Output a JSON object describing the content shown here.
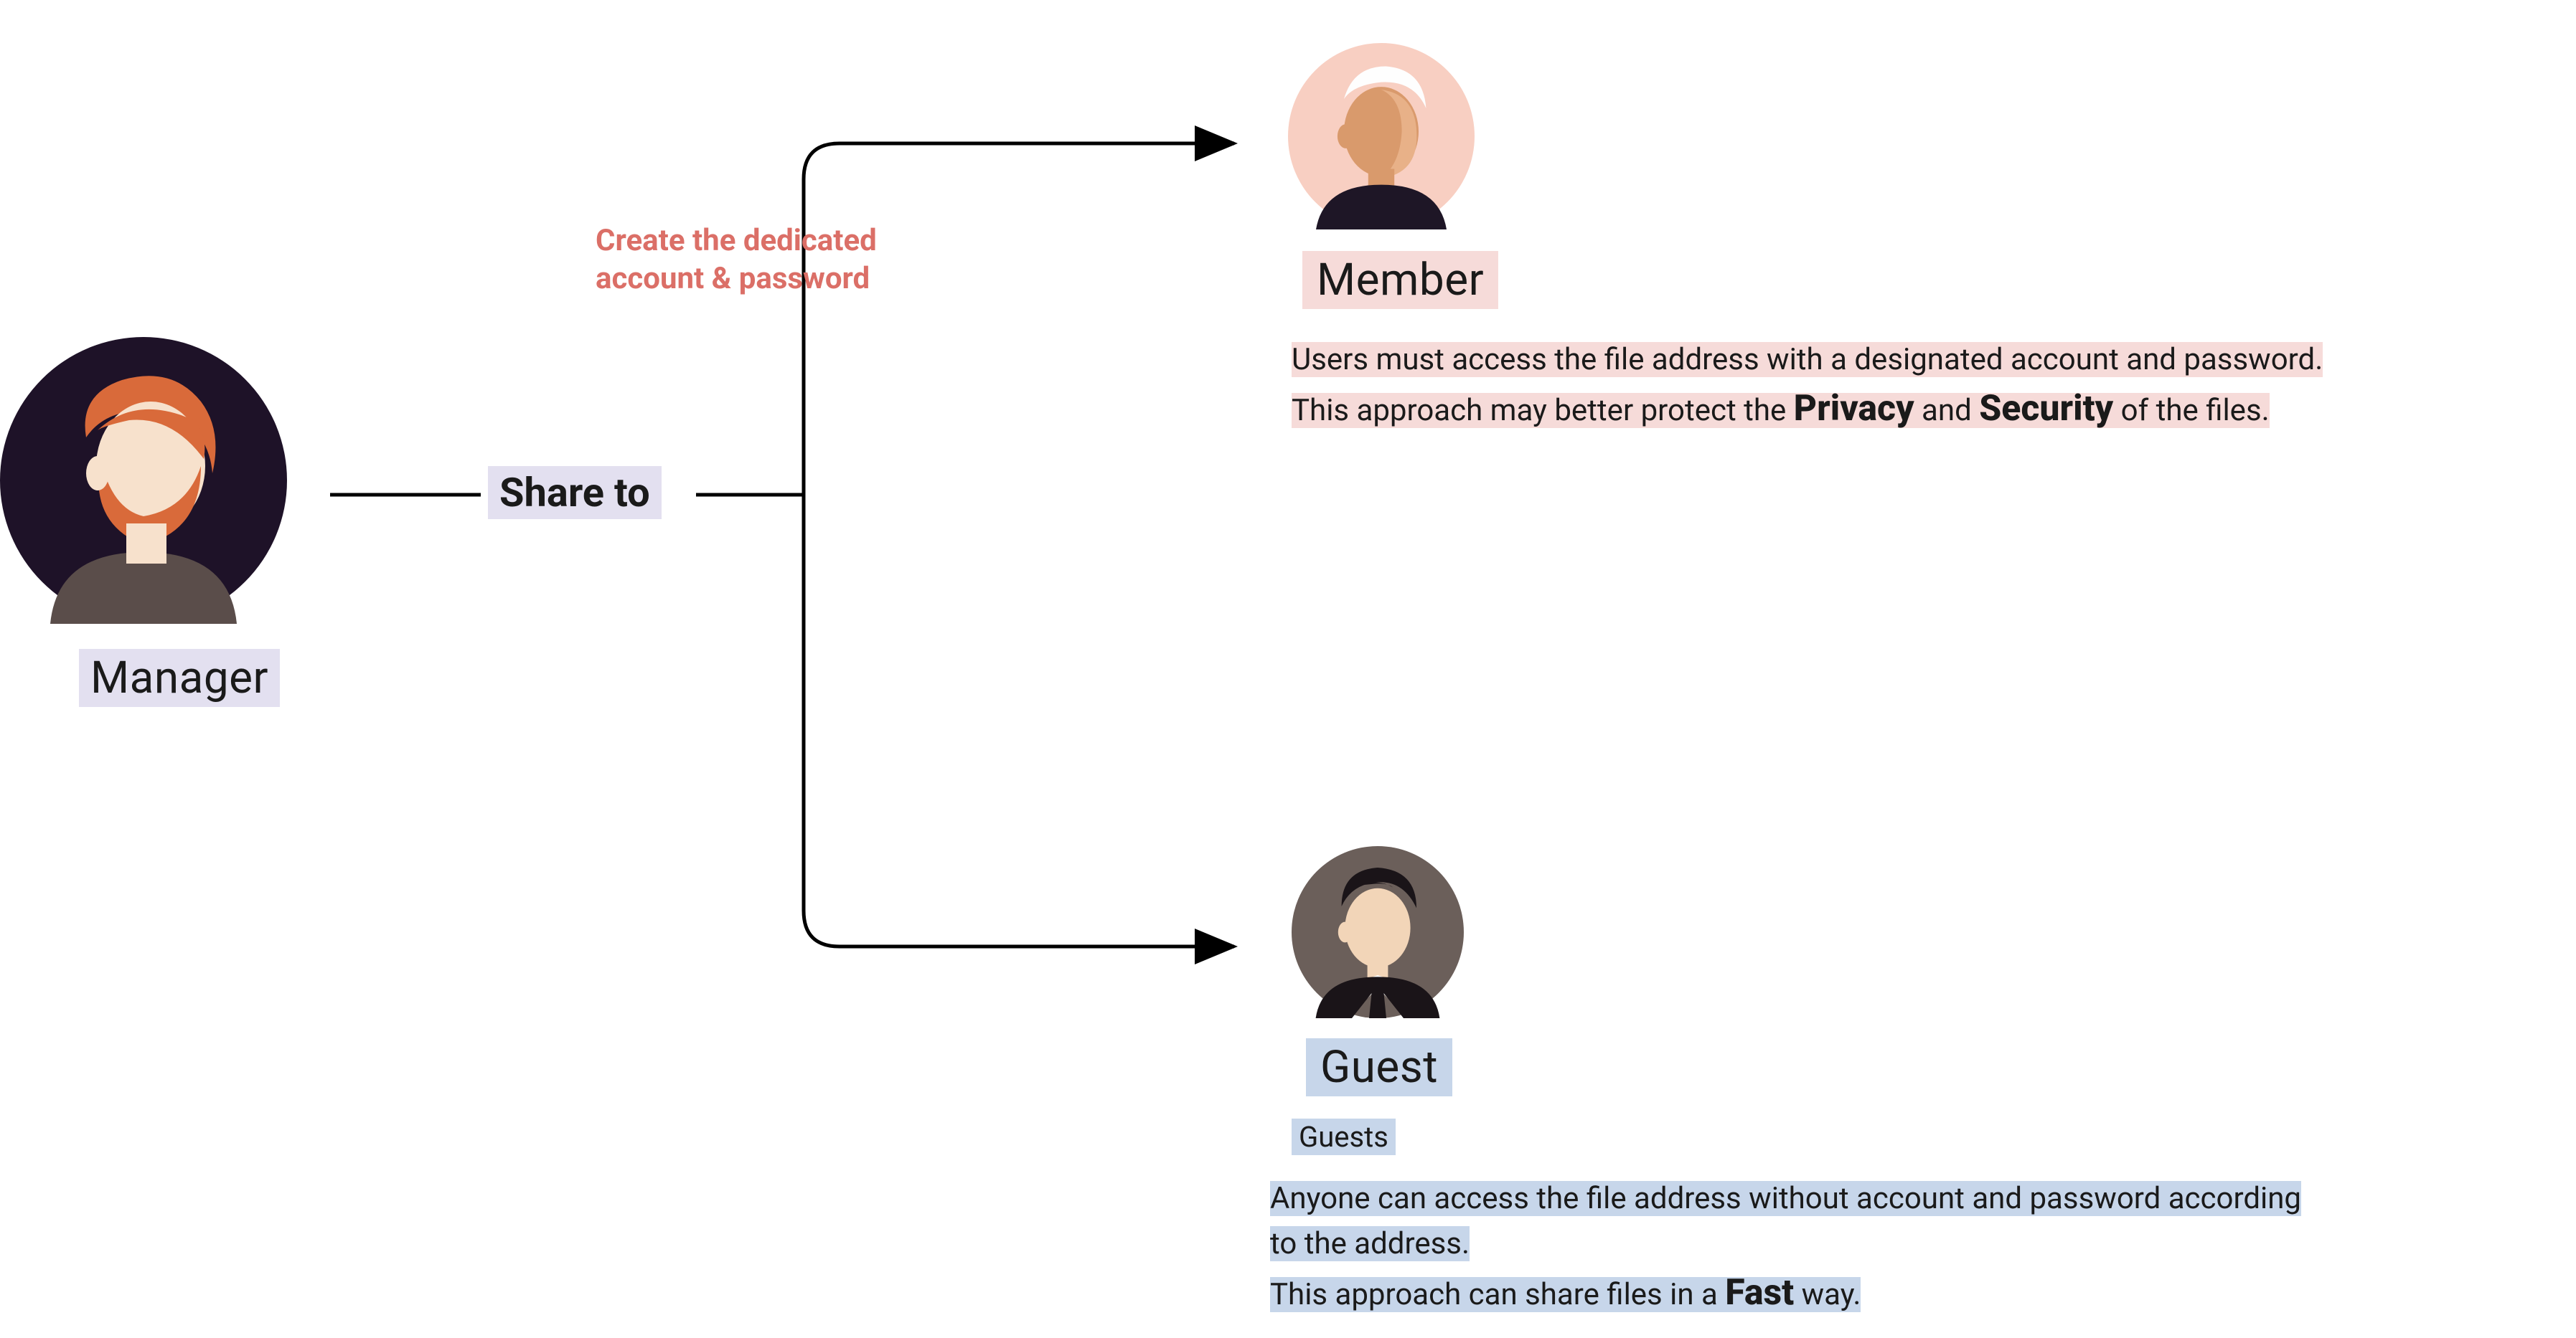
{
  "manager": {
    "label": "Manager"
  },
  "share_label": "Share to",
  "annotation_line1": "Create the dedicated",
  "annotation_line2": "account & password",
  "member": {
    "label": "Member",
    "desc_part1": "Users must access the file address with a designated account and password.",
    "desc_part2a": "This approach may better protect the ",
    "desc_bold1": "Privacy",
    "desc_part2b": " and ",
    "desc_bold2": "Security",
    "desc_part2c": " of the files."
  },
  "guest": {
    "label": "Guest",
    "subtitle": "Guests",
    "desc_part1": "  Anyone can access the file address without account and password according",
    "desc_part1b": "to the address.",
    "desc_part2a": "  This approach can share files in a ",
    "desc_bold": "Fast",
    "desc_part2b": " way."
  }
}
